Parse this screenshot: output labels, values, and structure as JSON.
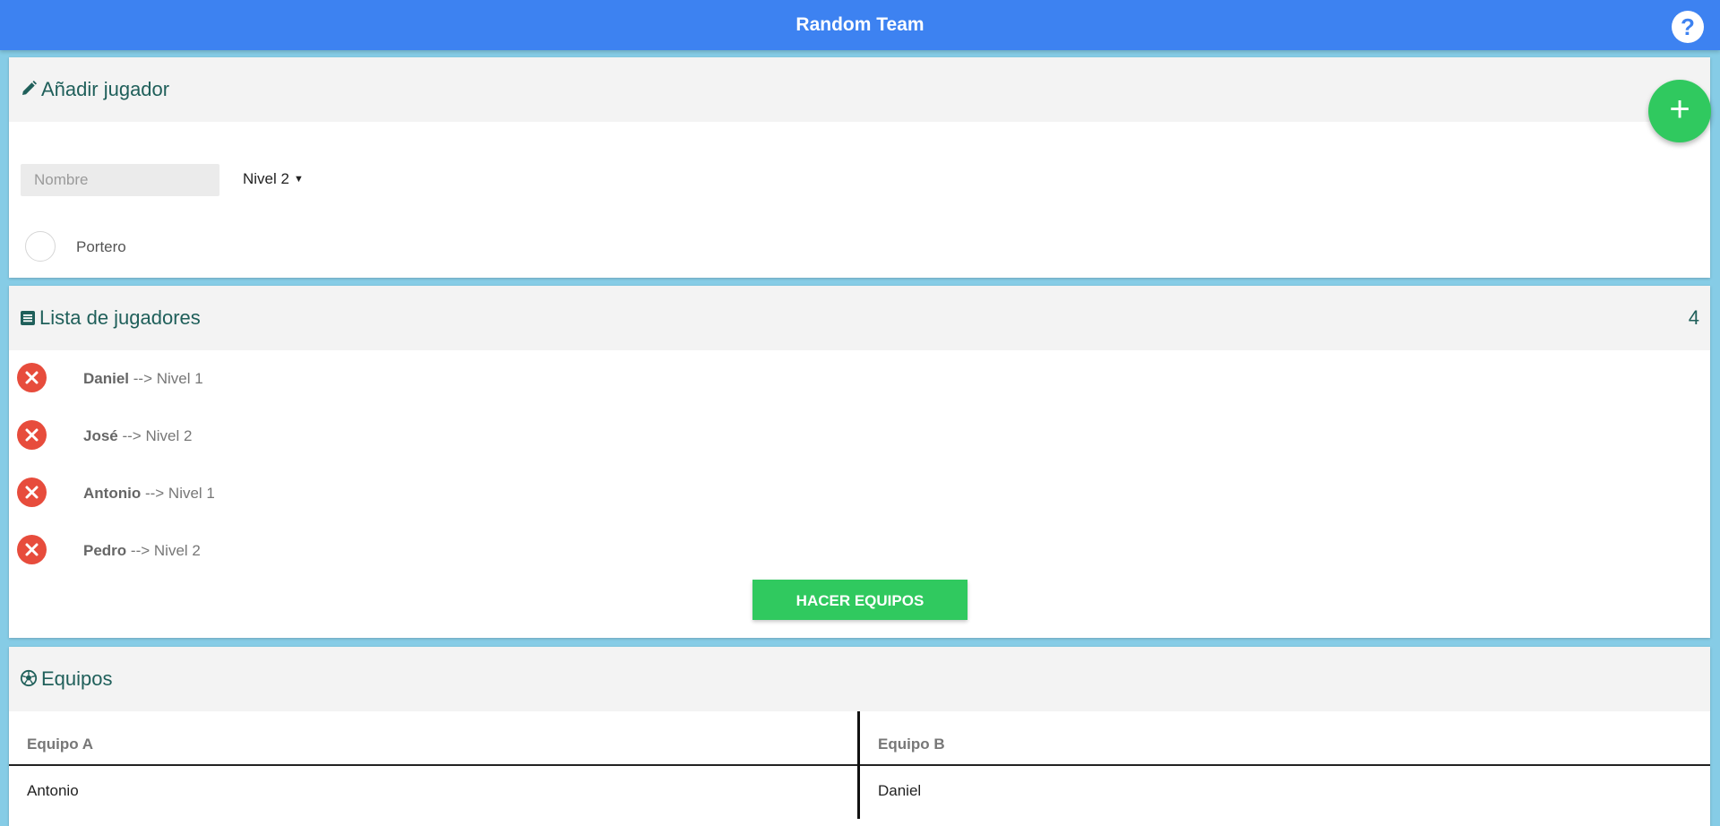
{
  "header": {
    "title": "Random Team",
    "help_icon": "question-icon",
    "help_label": "?"
  },
  "add_player": {
    "title": "Añadir jugador",
    "icon": "pencil-icon",
    "name_placeholder": "Nombre",
    "name_value": "",
    "level_selected": "Nivel 2",
    "goalkeeper_label": "Portero",
    "goalkeeper_checked": false,
    "add_button_label": "+"
  },
  "player_list": {
    "title": "Lista de jugadores",
    "icon": "list-icon",
    "count": "4",
    "players": [
      {
        "name": "Daniel",
        "arrow": "-->",
        "level": "Nivel 1"
      },
      {
        "name": "José",
        "arrow": "-->",
        "level": "Nivel 2"
      },
      {
        "name": "Antonio",
        "arrow": "-->",
        "level": "Nivel 1"
      },
      {
        "name": "Pedro",
        "arrow": "-->",
        "level": "Nivel 2"
      }
    ],
    "make_teams_label": "HACER EQUIPOS"
  },
  "teams": {
    "title": "Equipos",
    "icon": "soccer-ball-icon",
    "team_a": {
      "header": "Equipo A",
      "players": [
        "Antonio"
      ]
    },
    "team_b": {
      "header": "Equipo B",
      "players": [
        "Daniel"
      ]
    }
  },
  "colors": {
    "header_bg": "#3d82f1",
    "page_bg": "#86cce6",
    "accent_green": "#30c95f",
    "danger_red": "#e74c3c",
    "title_teal": "#1f5f5a"
  }
}
